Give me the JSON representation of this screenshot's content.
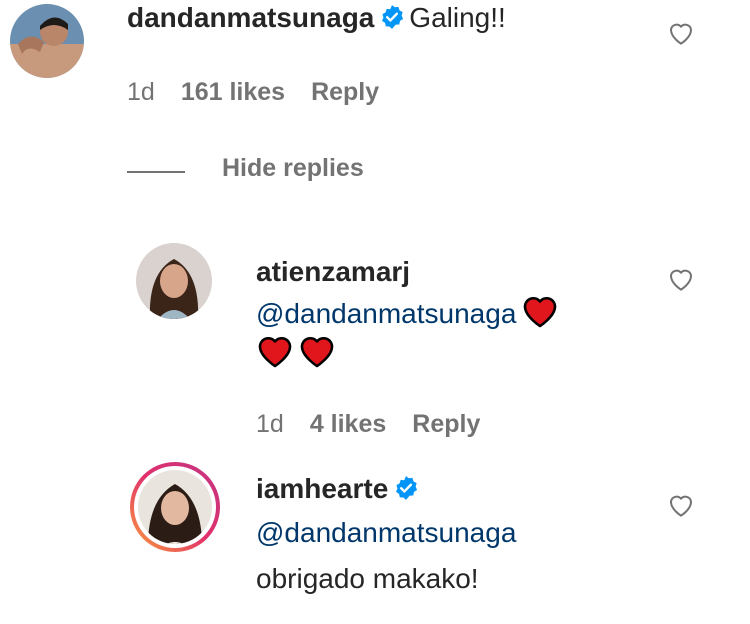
{
  "comments": [
    {
      "username": "dandanmatsunaga",
      "text": "Galing!!",
      "time": "1d",
      "likes": "161 likes",
      "reply_label": "Reply"
    }
  ],
  "hide_replies_label": "Hide replies",
  "replies": [
    {
      "username": "atienzamarj",
      "mention": "@dandanmatsunaga",
      "time": "1d",
      "likes": "4 likes",
      "reply_label": "Reply"
    },
    {
      "username": "iamhearte",
      "mention": "@dandanmatsunaga",
      "text": "obrigado makako!"
    }
  ],
  "icons": {
    "verified": "verified-badge-icon",
    "like": "heart-outline-icon",
    "emoji": "red-heart-emoji"
  },
  "colors": {
    "mention": "#00376b",
    "verified": "#0095f6",
    "meta": "#737373",
    "emoji_red": "#e0161c"
  }
}
